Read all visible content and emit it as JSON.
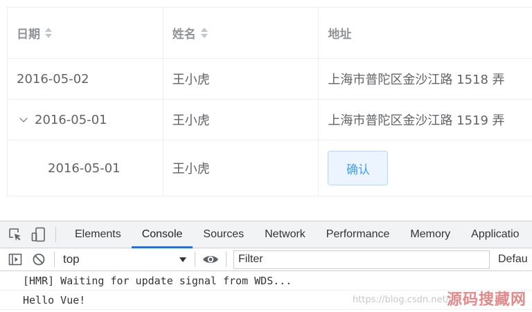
{
  "table": {
    "headers": {
      "date": "日期",
      "name": "姓名",
      "address": "地址"
    },
    "rows": [
      {
        "date": "2016-05-02",
        "name": "王小虎",
        "address": "上海市普陀区金沙江路 1518 弄"
      },
      {
        "date": "2016-05-01",
        "name": "王小虎",
        "address": "上海市普陀区金沙江路 1519 弄",
        "expanded": true
      },
      {
        "date": "2016-05-01",
        "name": "王小虎",
        "action_label": "确认"
      }
    ]
  },
  "devtools": {
    "tabs": [
      "Elements",
      "Console",
      "Sources",
      "Network",
      "Performance",
      "Memory",
      "Applicatio"
    ],
    "active_tab": "Console",
    "context": "top",
    "filter_placeholder": "Filter",
    "levels_label": "Defau",
    "console_lines": [
      "[HMR] Waiting for update signal from WDS...",
      "Hello Vue!"
    ],
    "accent_color": "#1a73e8"
  },
  "watermark": {
    "url": "https://blog.csdn.net/",
    "site": "源码搜藏网"
  }
}
